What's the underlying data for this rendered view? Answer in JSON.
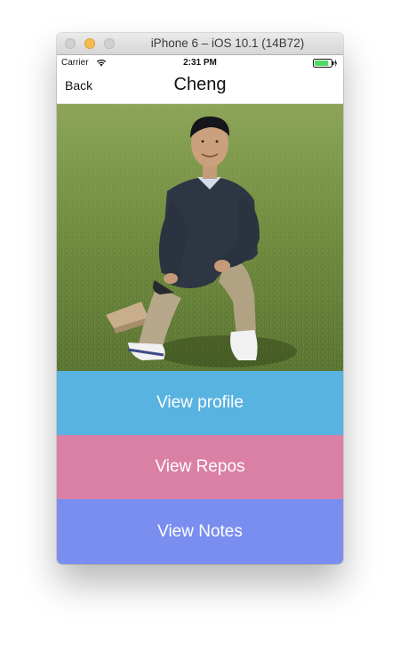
{
  "window": {
    "title": "iPhone 6 – iOS 10.1 (14B72)"
  },
  "status_bar": {
    "carrier": "Carrier",
    "time": "2:31 PM",
    "wifi_icon": "wifi-icon",
    "battery_icon": "battery-charging-icon",
    "battery_level": 0.85
  },
  "nav_bar": {
    "back_label": "Back",
    "title": "Cheng"
  },
  "buttons": [
    {
      "label": "View profile",
      "color": "#58b3e0"
    },
    {
      "label": "View Repos",
      "color": "#da80a4"
    },
    {
      "label": "View Notes",
      "color": "#7a8ef0"
    }
  ],
  "colors": {
    "battery_fill": "#4cd964"
  }
}
